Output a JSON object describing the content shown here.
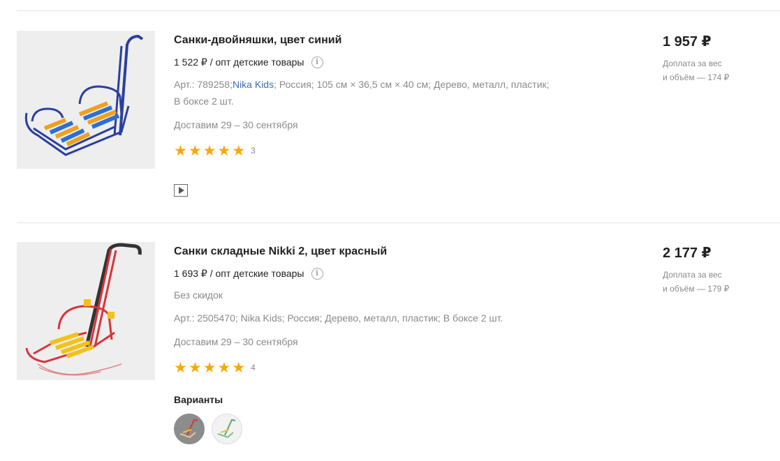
{
  "products": [
    {
      "title": "Санки-двойняшки, цвет синий",
      "wholesale_price": "1 522 ₽ / опт детские товары",
      "art": "Арт.: 789258;",
      "brand": "Nika Kids",
      "specs_line1": "; Россия;  105 см × 36,5 см × 40 см;  Дерево, металл, пластик;",
      "specs_line2": "В боксе 2 шт.",
      "delivery": "Доставим 29 – 30 сентября",
      "rating_count": "3",
      "rating": 5,
      "price": "1 957 ₽",
      "surcharge_line1": "Доплата за вес",
      "surcharge_line2": "и объём — 174 ₽",
      "image_icon": "blue-double-sled",
      "video_icon": "play-icon"
    },
    {
      "title": "Санки складные Nikki 2, цвет красный",
      "wholesale_price": "1 693 ₽ / опт детские товары",
      "discount_note": "Без скидок",
      "art": "Арт.: 2505470;",
      "brand": "Nika Kids",
      "specs_line1": ";  Россия;  Дерево, металл, пластик;  В боксе 2 шт.",
      "delivery": "Доставим 29 – 30 сентября",
      "rating_count": "4",
      "rating": 5,
      "price": "2 177 ₽",
      "surcharge_line1": "Доплата за вес",
      "surcharge_line2": "и объём — 179 ₽",
      "variants_label": "Варианты",
      "image_icon": "red-folding-sled",
      "variants": [
        "red-sled-variant",
        "green-sled-variant"
      ]
    }
  ],
  "colors": {
    "star": "#f6a80e",
    "link": "#3d6fb0",
    "muted": "#8a8a8a",
    "sled_blue": "#2b3fa0",
    "sled_red": "#d8343a"
  },
  "info_icon": "i"
}
